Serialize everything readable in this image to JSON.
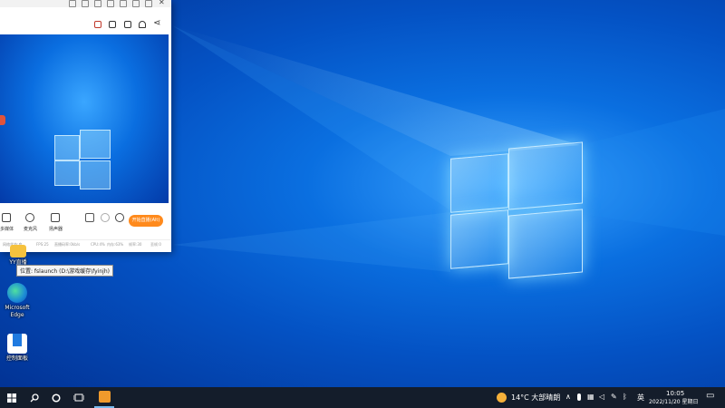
{
  "app_window": {
    "toolbar_icons": [
      "gift-icon",
      "lock-icon",
      "shop-icon",
      "bell-icon",
      "share-icon"
    ],
    "start_live_label": "开始直播(Alt)",
    "controls": [
      {
        "label": "多媒体",
        "icon": "media-icon"
      },
      {
        "label": "麦克风",
        "icon": "microphone-icon"
      },
      {
        "label": "扬声器",
        "icon": "speaker-icon"
      }
    ],
    "status_items": [
      "网络状态:良",
      "FPS:25",
      "直播码率:0kb/s",
      "CPU:4%",
      "内存:63%",
      "帧率:30",
      "丢帧:0"
    ]
  },
  "desktop": {
    "icons": [
      {
        "label": "YY直播",
        "icon": "yy-app-icon"
      },
      {
        "label": "Microsoft Edge",
        "icon": "edge-icon"
      },
      {
        "label": "控制面板",
        "icon": "control-panel-icon"
      }
    ],
    "tooltip": "位置: fslaunch (D:\\游戏缓存\\fyinjh)"
  },
  "taskbar": {
    "weather": "14°C 大部晴朗",
    "ime": "英",
    "time": "10:05",
    "date": "2022/11/20 星期日"
  }
}
